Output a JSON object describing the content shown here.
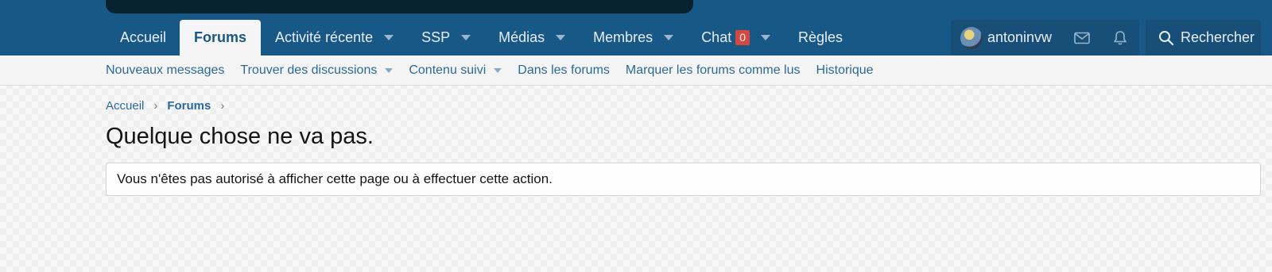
{
  "nav": {
    "items": [
      {
        "label": "Accueil",
        "active": false,
        "dropdown": false
      },
      {
        "label": "Forums",
        "active": true,
        "dropdown": false
      },
      {
        "label": "Activité récente",
        "active": false,
        "dropdown": true
      },
      {
        "label": "SSP",
        "active": false,
        "dropdown": true
      },
      {
        "label": "Médias",
        "active": false,
        "dropdown": true
      },
      {
        "label": "Membres",
        "active": false,
        "dropdown": true
      },
      {
        "label": "Chat",
        "active": false,
        "dropdown": true,
        "badge": "0"
      },
      {
        "label": "Règles",
        "active": false,
        "dropdown": false
      }
    ]
  },
  "user": {
    "name": "antoninvw",
    "icons": [
      "envelope-icon",
      "bell-icon"
    ]
  },
  "search": {
    "label": "Rechercher",
    "icon": "search-icon"
  },
  "subnav": {
    "items": [
      {
        "label": "Nouveaux messages",
        "dropdown": false
      },
      {
        "label": "Trouver des discussions",
        "dropdown": true
      },
      {
        "label": "Contenu suivi",
        "dropdown": true
      },
      {
        "label": "Dans les forums",
        "dropdown": false
      },
      {
        "label": "Marquer les forums comme lus",
        "dropdown": false
      },
      {
        "label": "Historique",
        "dropdown": false
      }
    ]
  },
  "breadcrumb": {
    "items": [
      "Accueil",
      "Forums"
    ]
  },
  "page": {
    "title": "Quelque chose ne va pas.",
    "message": "Vous n'êtes pas autorisé à afficher cette page ou à effectuer cette action."
  },
  "colors": {
    "header": "#185886",
    "badge": "#d8473d",
    "link": "#2b6a98"
  }
}
